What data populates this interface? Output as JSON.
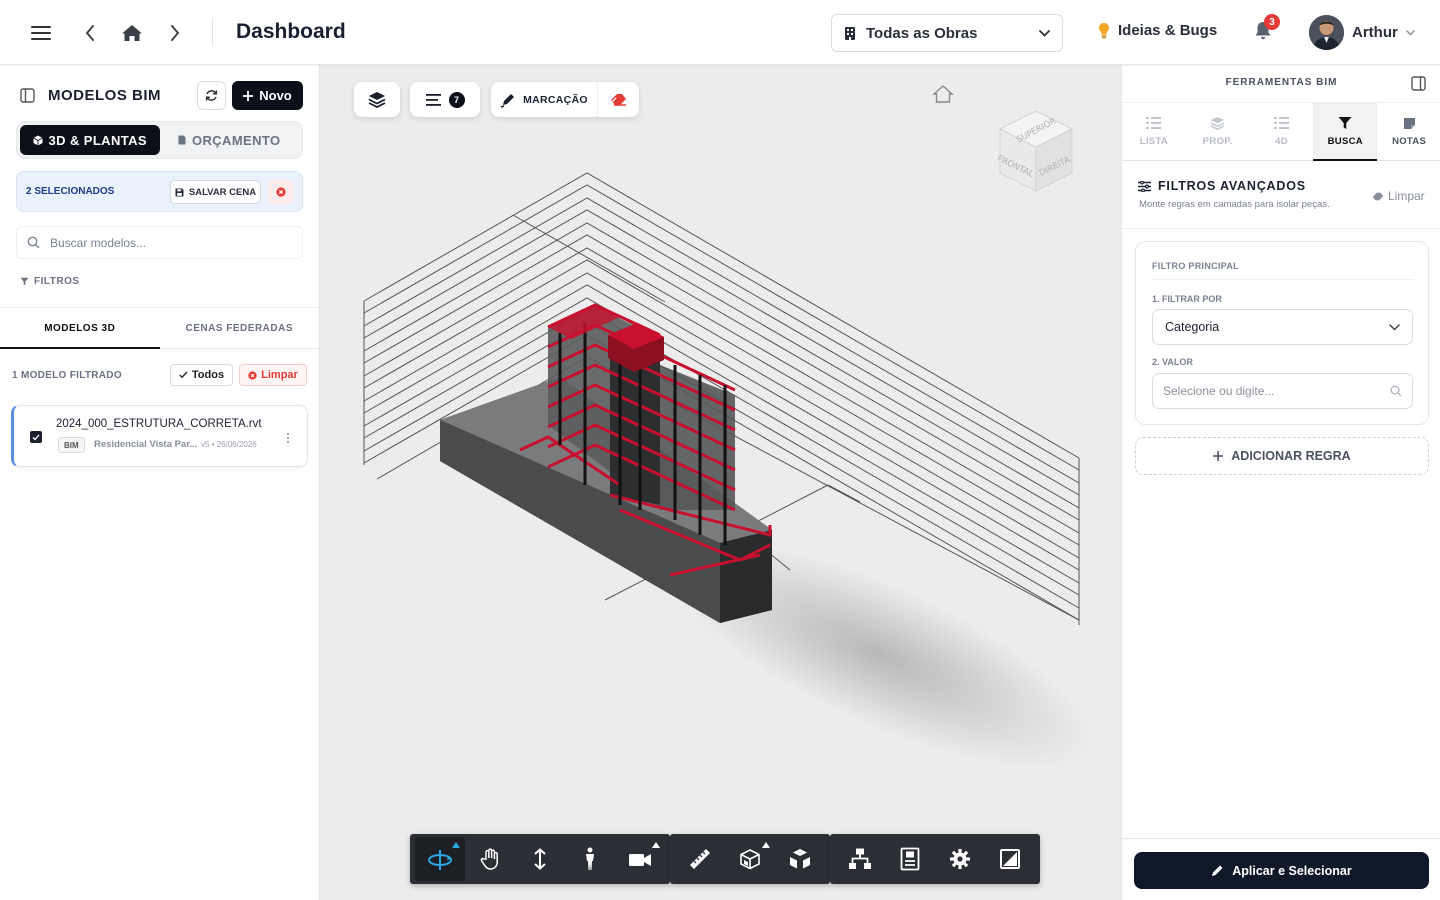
{
  "header": {
    "title": "Dashboard",
    "obra_select": "Todas as Obras",
    "ideias_label": "Ideias & Bugs",
    "notifications_count": "3",
    "user_name": "Arthur"
  },
  "left_panel": {
    "title": "MODELOS BIM",
    "new_button": "Novo",
    "segments": [
      "3D & PLANTAS",
      "ORÇAMENTO"
    ],
    "selection": {
      "count_label": "2 SELECIONADOS",
      "save_scene": "SALVAR CENA"
    },
    "search_placeholder": "Buscar modelos...",
    "filters_label": "FILTROS",
    "tabs": [
      "MODELOS 3D",
      "CENAS FEDERADAS"
    ],
    "filtered_count": "1 MODELO FILTRADO",
    "todos_button": "Todos",
    "limpar_button": "Limpar",
    "models": [
      {
        "name": "2024_000_ESTRUTURA_CORRETA.rvt",
        "tag": "BIM",
        "project": "Residencial Vista Par...",
        "version": "v5 • 26/06/2026"
      }
    ]
  },
  "viewer": {
    "layers_count": "7",
    "markup_label": "MARCAÇÃO",
    "viewcube_labels": [
      "SUPERIOR",
      "FRONTAL",
      "DIREITA"
    ],
    "bottom_toolbar": {
      "navigation": [
        "orbit-icon",
        "pan-icon",
        "zoom-icon",
        "first-person-icon",
        "camera-icon"
      ],
      "measure": [
        "measure-icon",
        "section-icon",
        "explode-icon"
      ],
      "settings": [
        "model-browser-icon",
        "properties-icon",
        "settings-icon",
        "fullscreen-icon"
      ]
    },
    "colors": {
      "structure_highlight": "#c8102e",
      "structure_dark": "#3c3d3f"
    }
  },
  "right_panel": {
    "title": "FERRAMENTAS BIM",
    "tabs": [
      "LISTA",
      "PROP.",
      "4D",
      "BUSCA",
      "NOTAS"
    ],
    "active_tab": "BUSCA",
    "filters": {
      "title": "FILTROS AVANÇADOS",
      "subtitle": "Monte regras em camadas para isolar peças.",
      "clear": "Limpar",
      "main_filter_label": "FILTRO PRINCIPAL",
      "filter_by_label": "1. FILTRAR POR",
      "filter_by_value": "Categoria",
      "value_label": "2. VALOR",
      "value_placeholder": "Selecione ou digite...",
      "add_rule": "ADICIONAR REGRA"
    },
    "apply_button": "Aplicar e Selecionar"
  }
}
